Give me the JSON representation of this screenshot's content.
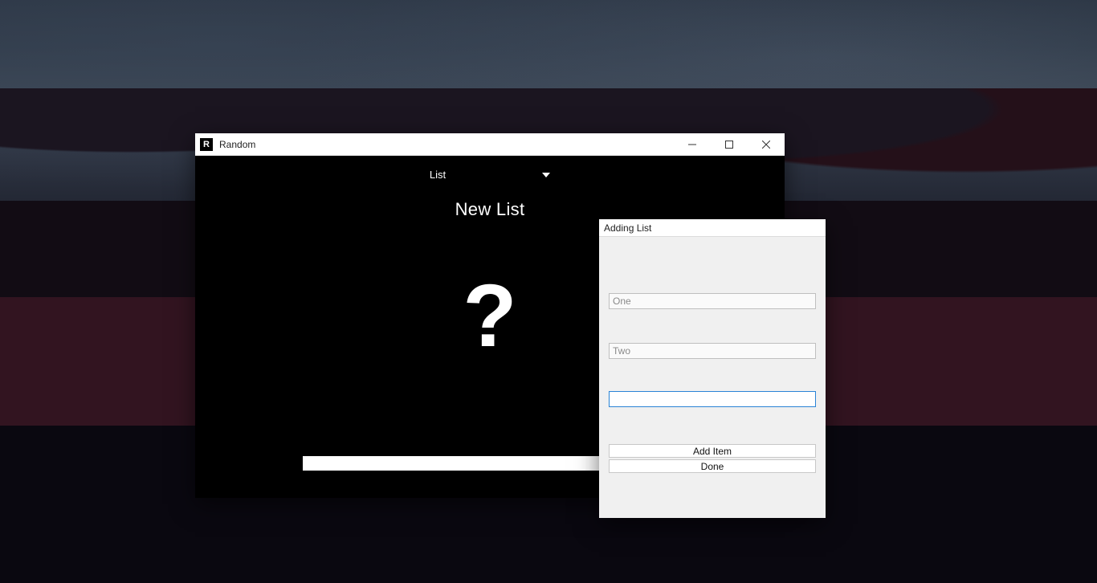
{
  "main_window": {
    "title": "Random",
    "mode_label": "List",
    "list_name": "New List",
    "center_glyph": "?",
    "app_icon_letter": "R"
  },
  "dialog": {
    "title": "Adding List",
    "inputs": [
      {
        "value": "One"
      },
      {
        "value": "Two"
      },
      {
        "value": ""
      }
    ],
    "buttons": {
      "add_item": "Add Item",
      "done": "Done"
    }
  }
}
